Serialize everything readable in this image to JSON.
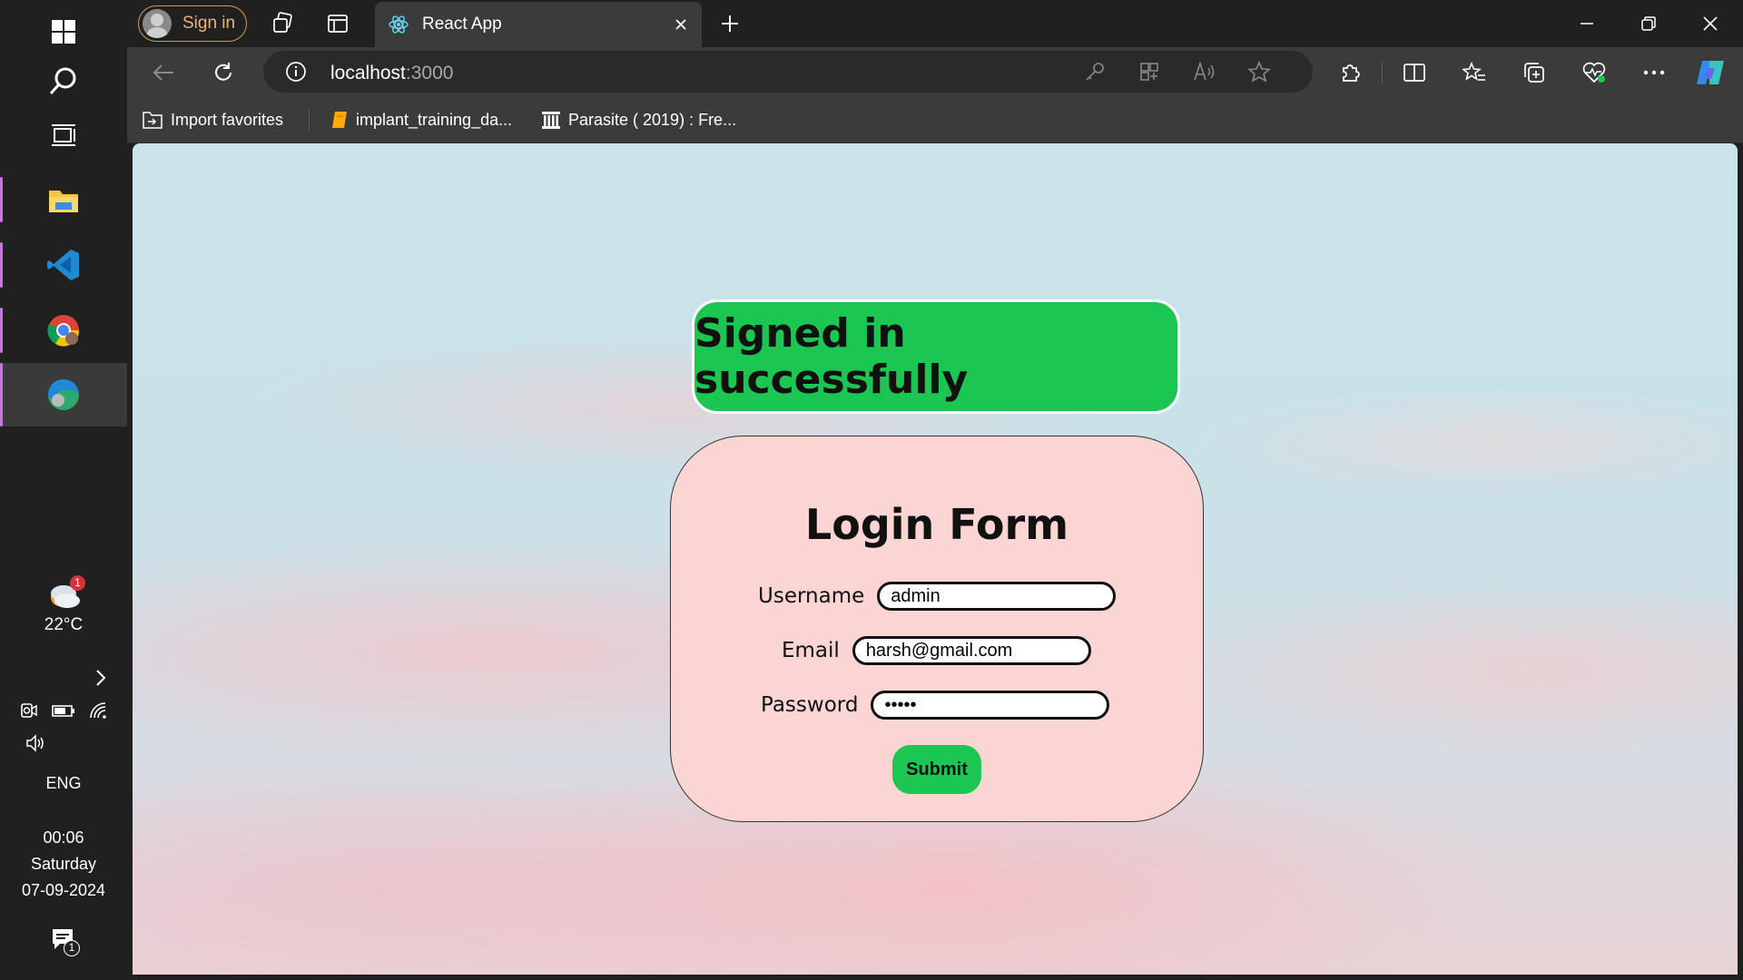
{
  "taskbar": {
    "apps": [
      {
        "name": "File Explorer"
      },
      {
        "name": "Visual Studio Code"
      },
      {
        "name": "Google Chrome"
      },
      {
        "name": "Microsoft Edge"
      }
    ],
    "weather": {
      "temp": "22°C",
      "badge": "1"
    },
    "language": "ENG",
    "clock": {
      "time": "00:06",
      "day": "Saturday",
      "date": "07-09-2024"
    },
    "notification_count": "1"
  },
  "browser": {
    "signin_label": "Sign in",
    "tab_title": "React App",
    "address": {
      "host": "localhost",
      "port": ":3000"
    },
    "favorites": [
      {
        "label": "Import favorites"
      },
      {
        "label": "implant_training_da..."
      },
      {
        "label": "Parasite ( 2019) : Fre..."
      }
    ]
  },
  "page": {
    "success_message": "Signed in successfully",
    "form": {
      "title": "Login Form",
      "username_label": "Username",
      "username_value": "admin",
      "email_label": "Email",
      "email_value": "harsh@gmail.com",
      "password_label": "Password",
      "password_value": "•••••",
      "submit_label": "Submit"
    }
  },
  "colors": {
    "success_green": "#1cc653",
    "card_pink": "#fbd5d4",
    "browser_dark": "#202020",
    "toolbar": "#3b3b3b"
  }
}
